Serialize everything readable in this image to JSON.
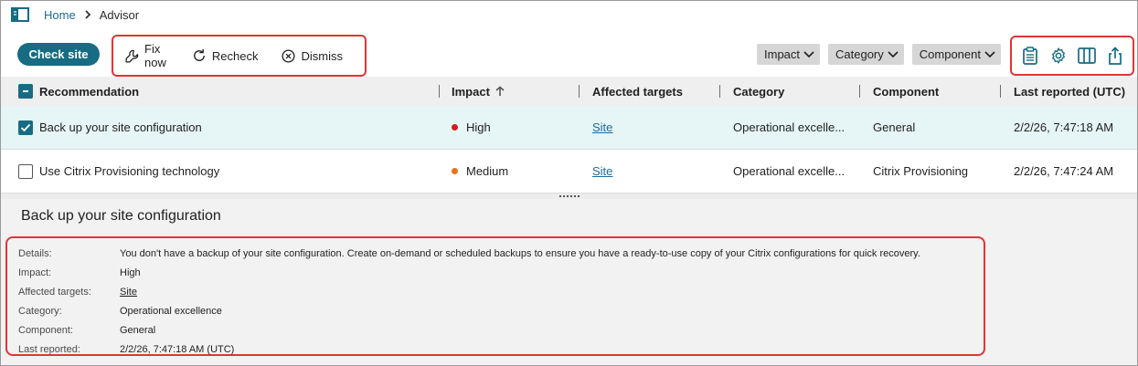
{
  "breadcrumb": {
    "home": "Home",
    "current": "Advisor"
  },
  "toolbar": {
    "check_site": "Check site",
    "actions": {
      "fix_now": "Fix now",
      "recheck": "Recheck",
      "dismiss": "Dismiss"
    },
    "filters": {
      "impact": "Impact",
      "category": "Category",
      "component": "Component"
    }
  },
  "table": {
    "headers": {
      "recommendation": "Recommendation",
      "impact": "Impact",
      "affected_targets": "Affected targets",
      "category": "Category",
      "component": "Component",
      "last_reported": "Last reported (UTC)"
    },
    "rows": [
      {
        "recommendation": "Back up your site configuration",
        "impact": "High",
        "affected_targets": "Site",
        "category": "Operational excelle...",
        "component": "General",
        "last_reported": "2/2/26, 7:47:18 AM",
        "selected": true
      },
      {
        "recommendation": "Use Citrix Provisioning technology",
        "impact": "Medium",
        "affected_targets": "Site",
        "category": "Operational excelle...",
        "component": "Citrix Provisioning",
        "last_reported": "2/2/26, 7:47:24 AM",
        "selected": false
      }
    ]
  },
  "detail": {
    "title": "Back up your site configuration",
    "labels": {
      "details": "Details:",
      "impact": "Impact:",
      "affected_targets": "Affected targets:",
      "category": "Category:",
      "component": "Component:",
      "last_reported": "Last reported:"
    },
    "values": {
      "details": "You don't have a backup of your site configuration. Create on-demand or scheduled backups to ensure you have a ready-to-use copy of your Citrix configurations for quick recovery.",
      "impact": "High",
      "affected_targets": "Site",
      "category": "Operational excellence",
      "component": "General",
      "last_reported": "2/2/26, 7:47:18 AM (UTC)"
    }
  },
  "colors": {
    "primary": "#176c83",
    "link": "#1a6a9a",
    "high": "#d01c1c",
    "medium": "#e8731a",
    "highlight": "#e03535",
    "selected_row": "#e6f5f5"
  },
  "icons": [
    "sidebar-toggle-icon",
    "chevron-right-icon",
    "wrench-icon",
    "refresh-icon",
    "close-circle-icon",
    "chevron-down-icon",
    "clipboard-icon",
    "gear-icon",
    "columns-icon",
    "share-icon",
    "sort-up-icon",
    "checkbox-icon"
  ]
}
